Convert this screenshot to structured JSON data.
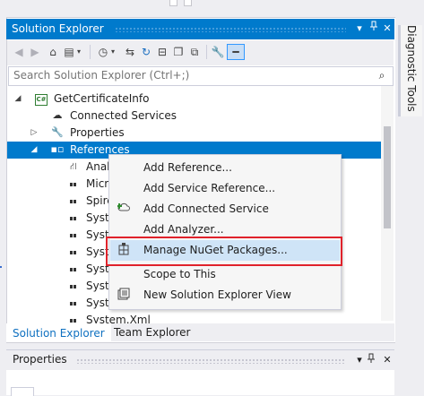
{
  "solution_explorer": {
    "title": "Solution Explorer",
    "header_buttons": [
      "▾",
      "📌",
      "✕"
    ],
    "search_placeholder": "Search Solution Explorer (Ctrl+;)"
  },
  "tree": [
    {
      "label": "GetCertificateInfo",
      "icon": "csharp-project-icon",
      "expander": "◢"
    },
    {
      "label": "Connected Services",
      "icon": "cloud-icon",
      "expander": ""
    },
    {
      "label": "Properties",
      "icon": "wrench-icon",
      "expander": "▷"
    },
    {
      "label": "References",
      "icon": "references-icon",
      "expander": "◢",
      "selected": true
    },
    {
      "label": "Analy",
      "icon": "analyzer-icon"
    },
    {
      "label": "Micr",
      "icon": "reference-icon"
    },
    {
      "label": "Spire",
      "icon": "reference-icon"
    },
    {
      "label": "Syste",
      "icon": "reference-icon"
    },
    {
      "label": "Syste",
      "icon": "reference-icon"
    },
    {
      "label": "Syste",
      "icon": "reference-icon"
    },
    {
      "label": "Syste",
      "icon": "reference-icon"
    },
    {
      "label": "Syste",
      "icon": "reference-icon"
    },
    {
      "label": "Syste",
      "icon": "reference-icon"
    },
    {
      "label": "System.Xml",
      "icon": "reference-icon"
    }
  ],
  "context_menu": [
    {
      "label": "Add Reference...",
      "icon": ""
    },
    {
      "label": "Add Service Reference...",
      "icon": ""
    },
    {
      "label": "Add Connected Service",
      "icon": "add-connected-service-icon"
    },
    {
      "label": "Add Analyzer...",
      "icon": ""
    },
    {
      "label": "Manage NuGet Packages...",
      "icon": "nuget-icon",
      "highlighted": true
    },
    {
      "label": "Scope to This",
      "icon": ""
    },
    {
      "label": "New Solution Explorer View",
      "icon": "new-view-icon"
    }
  ],
  "bottom_tabs": [
    "Solution Explorer",
    "Team Explorer"
  ],
  "properties": {
    "title": "Properties",
    "header_buttons": [
      "▾",
      "📌",
      "✕"
    ]
  },
  "right_rail": {
    "tab_label": "Diagnostic Tools"
  },
  "colors": {
    "accent": "#007acc",
    "highlight_box": "#e0222b",
    "menu_hover": "#cfe4f7"
  }
}
